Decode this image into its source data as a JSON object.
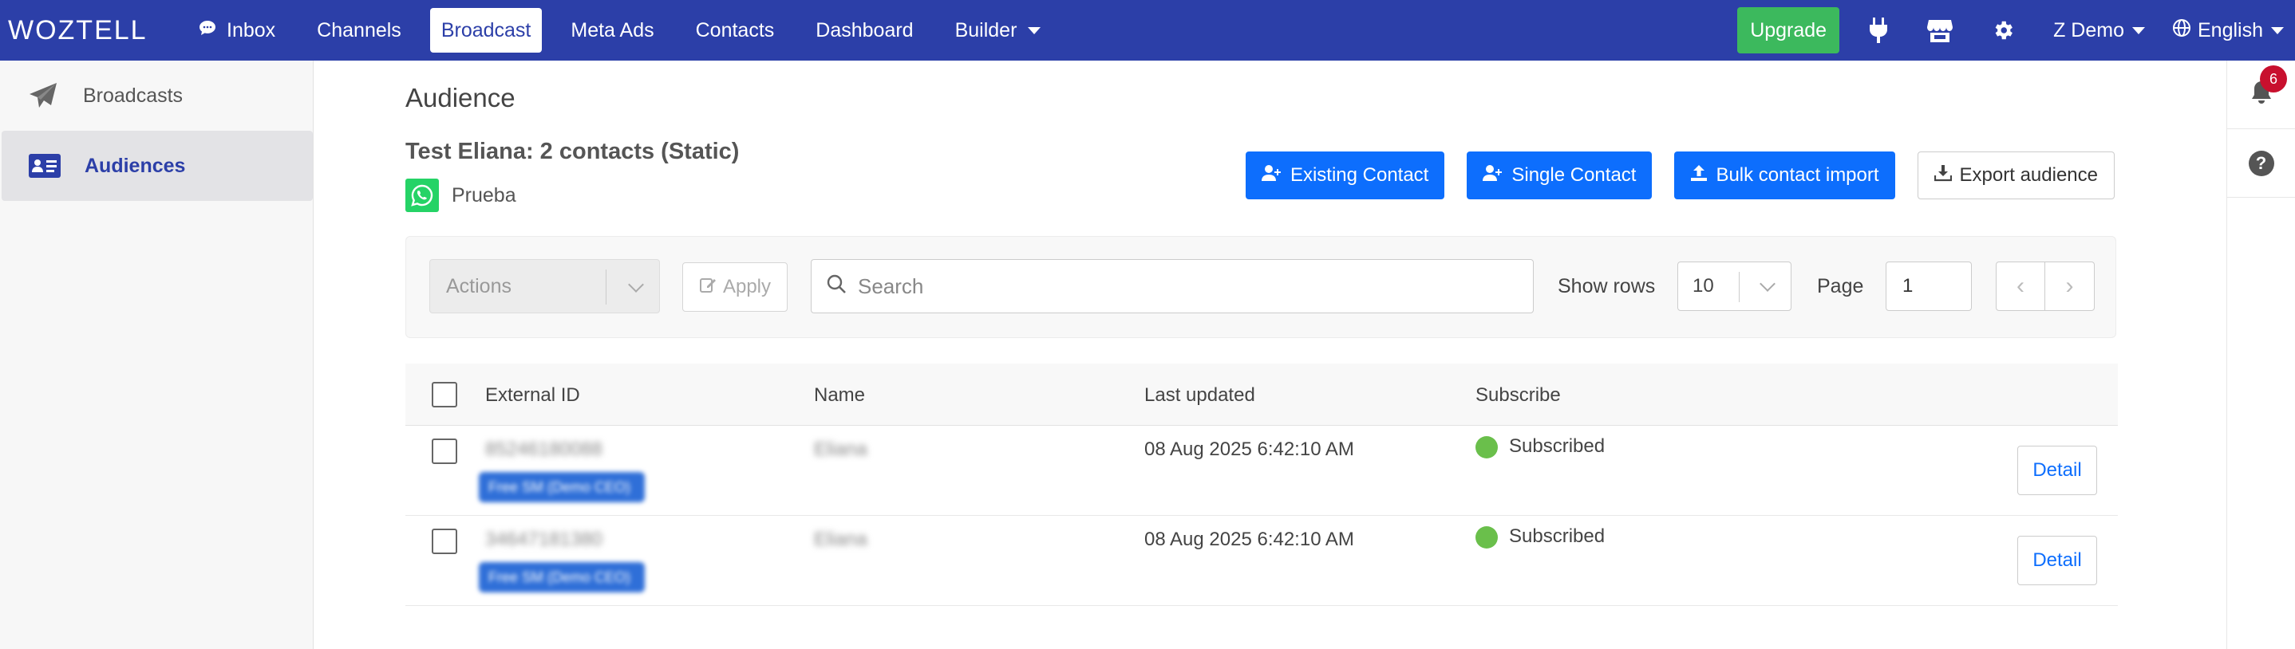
{
  "brand": "WOZTELL",
  "nav": {
    "items": [
      {
        "label": "Inbox",
        "icon": "chat-icon"
      },
      {
        "label": "Channels"
      },
      {
        "label": "Broadcast",
        "active": true
      },
      {
        "label": "Meta Ads"
      },
      {
        "label": "Contacts"
      },
      {
        "label": "Dashboard"
      },
      {
        "label": "Builder",
        "dropdown": true
      }
    ],
    "upgrade": "Upgrade",
    "user": "Z Demo",
    "language": "English"
  },
  "sidebar": {
    "items": [
      {
        "label": "Broadcasts",
        "icon": "paper-plane-icon"
      },
      {
        "label": "Audiences",
        "icon": "id-card-icon",
        "active": true
      }
    ]
  },
  "rail": {
    "notifications": "6"
  },
  "main": {
    "title": "Audience",
    "audience_title": "Test Eliana: 2 contacts (Static)",
    "channel_name": "Prueba",
    "buttons": {
      "existing": "Existing Contact",
      "single": "Single Contact",
      "bulk": "Bulk contact import",
      "export": "Export audience"
    },
    "toolbar": {
      "actions": "Actions",
      "apply": "Apply",
      "search_placeholder": "Search",
      "show_rows_label": "Show rows",
      "rows_value": "10",
      "page_label": "Page",
      "page_value": "1"
    },
    "table": {
      "headers": [
        "External ID",
        "Name",
        "Last updated",
        "Subscribe"
      ],
      "rows": [
        {
          "external_id": "85246180088",
          "tag": "Free SM (Demo CEO)",
          "name": "Eliana",
          "last_updated": "08 Aug 2025 6:42:10 AM",
          "subscribe": "Subscribed",
          "action": "Detail"
        },
        {
          "external_id": "34647181380",
          "tag": "Free SM (Demo CEO)",
          "name": "Eliana",
          "last_updated": "08 Aug 2025 6:42:10 AM",
          "subscribe": "Subscribed",
          "action": "Detail"
        }
      ]
    }
  },
  "colors": {
    "nav_bg": "#2c3fa8",
    "primary": "#0d6efd",
    "success": "#3cb95d",
    "whatsapp": "#25d366"
  }
}
